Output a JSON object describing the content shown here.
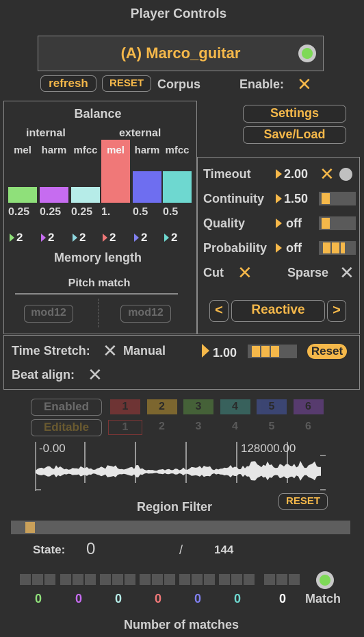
{
  "header": {
    "title": "Player Controls",
    "player_name": "(A) Marco_guitar"
  },
  "corpus": {
    "refresh_label": "refresh",
    "reset_label": "RESET",
    "corpus_label": "Corpus",
    "enable_label": "Enable:"
  },
  "balance": {
    "title": "Balance",
    "internal_label": "internal",
    "external_label": "external",
    "bars": [
      {
        "label": "mel",
        "value_text": "0.25",
        "value": 0.25,
        "mem": "2",
        "color": "#8fe07a",
        "arrow": "#8fe07a"
      },
      {
        "label": "harm",
        "value_text": "0.25",
        "value": 0.25,
        "mem": "2",
        "color": "#c66cf0",
        "arrow": "#c66cf0"
      },
      {
        "label": "mfcc",
        "value_text": "0.25",
        "value": 0.25,
        "mem": "2",
        "color": "#b6ece8",
        "arrow": "#8fd8e0"
      },
      {
        "label": "mel",
        "value_text": "1.",
        "value": 1.0,
        "mem": "2",
        "color": "#f07878",
        "arrow": "#f07878"
      },
      {
        "label": "harm",
        "value_text": "0.5",
        "value": 0.5,
        "mem": "2",
        "color": "#6e6ef0",
        "arrow": "#8080f0"
      },
      {
        "label": "mfcc",
        "value_text": "0.5",
        "value": 0.5,
        "mem": "2",
        "color": "#6ed8d0",
        "arrow": "#6ed8d0"
      }
    ],
    "memory_label": "Memory length",
    "pitch_label": "Pitch match",
    "mod_left": "mod12",
    "mod_right": "mod12"
  },
  "settings": {
    "settings_label": "Settings",
    "saveload_label": "Save/Load"
  },
  "params": {
    "timeout_label": "Timeout",
    "timeout_value": "2.00",
    "continuity_label": "Continuity",
    "continuity_value": "1.50",
    "continuity_level": 0.3,
    "quality_label": "Quality",
    "quality_value": "off",
    "quality_level": 0.3,
    "probability_label": "Probability",
    "probability_value": "off",
    "probability_level": 0.6,
    "cut_label": "Cut",
    "sparse_label": "Sparse",
    "mode_prev": "<",
    "mode_name": "Reactive",
    "mode_next": ">"
  },
  "stretch": {
    "label": "Time Stretch:",
    "manual_label": "Manual",
    "value": "1.00",
    "level": 0.55,
    "reset_label": "Reset",
    "beat_label": "Beat align:"
  },
  "regions": {
    "enabled_label": "Enabled",
    "editable_label": "Editable",
    "row1": [
      {
        "n": "1",
        "color": "#7a3535"
      },
      {
        "n": "2",
        "color": "#8a7030"
      },
      {
        "n": "3",
        "color": "#4a6a3a"
      },
      {
        "n": "4",
        "color": "#3a6a64"
      },
      {
        "n": "5",
        "color": "#3e4a7e"
      },
      {
        "n": "6",
        "color": "#5e3e7a"
      }
    ],
    "row2": [
      "1",
      "2",
      "3",
      "4",
      "5",
      "6"
    ],
    "time_start": "-0.00",
    "time_end": "128000.00"
  },
  "region_filter": {
    "title": "Region Filter",
    "reset_label": "RESET",
    "state_label": "State:",
    "state_value": "0",
    "slash": "/",
    "total": "144",
    "progress": 0.03
  },
  "matches": {
    "counts": [
      {
        "v": "0",
        "color": "#8fe07a"
      },
      {
        "v": "0",
        "color": "#c66cf0"
      },
      {
        "v": "0",
        "color": "#b6ece8"
      },
      {
        "v": "0",
        "color": "#f07878"
      },
      {
        "v": "0",
        "color": "#8080f0"
      },
      {
        "v": "0",
        "color": "#6ed8d0"
      },
      {
        "v": "0",
        "color": "#ffffff"
      }
    ],
    "match_label": "Match",
    "footer": "Number of matches"
  }
}
